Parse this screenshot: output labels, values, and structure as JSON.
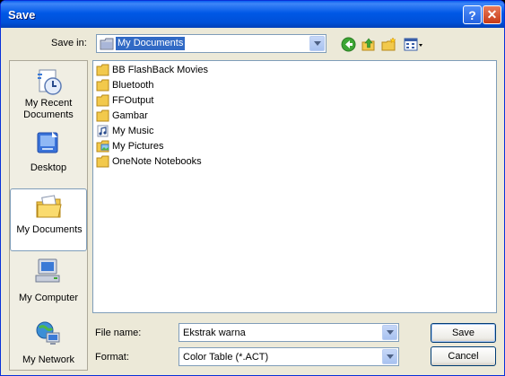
{
  "window": {
    "title": "Save",
    "help_glyph": "?",
    "close_glyph": "✕"
  },
  "toolbar": {
    "save_in_label": "Save in:",
    "save_in_value": "My Documents",
    "tools": [
      "back-icon",
      "up-folder-icon",
      "new-folder-icon",
      "view-menu-icon"
    ]
  },
  "places": [
    {
      "label": "My Recent Documents",
      "icon": "recent-documents-icon"
    },
    {
      "label": "Desktop",
      "icon": "desktop-icon"
    },
    {
      "label": "My Documents",
      "icon": "my-documents-icon",
      "selected": true
    },
    {
      "label": "My Computer",
      "icon": "my-computer-icon"
    },
    {
      "label": "My Network",
      "icon": "my-network-icon"
    }
  ],
  "files": [
    {
      "name": "BB FlashBack Movies",
      "icon": "folder-icon"
    },
    {
      "name": "Bluetooth",
      "icon": "folder-icon"
    },
    {
      "name": "FFOutput",
      "icon": "folder-icon"
    },
    {
      "name": "Gambar",
      "icon": "folder-icon"
    },
    {
      "name": "My Music",
      "icon": "music-folder-icon"
    },
    {
      "name": "My Pictures",
      "icon": "pictures-folder-icon"
    },
    {
      "name": "OneNote Notebooks",
      "icon": "folder-icon"
    }
  ],
  "bottom": {
    "file_name_label": "File name:",
    "file_name_value": "Ekstrak warna",
    "format_label": "Format:",
    "format_value": "Color Table (*.ACT)",
    "save_label": "Save",
    "cancel_label": "Cancel"
  },
  "colors": {
    "accent": "#316AC5",
    "titlebar": "#0058E6",
    "face": "#ECE9D8"
  }
}
